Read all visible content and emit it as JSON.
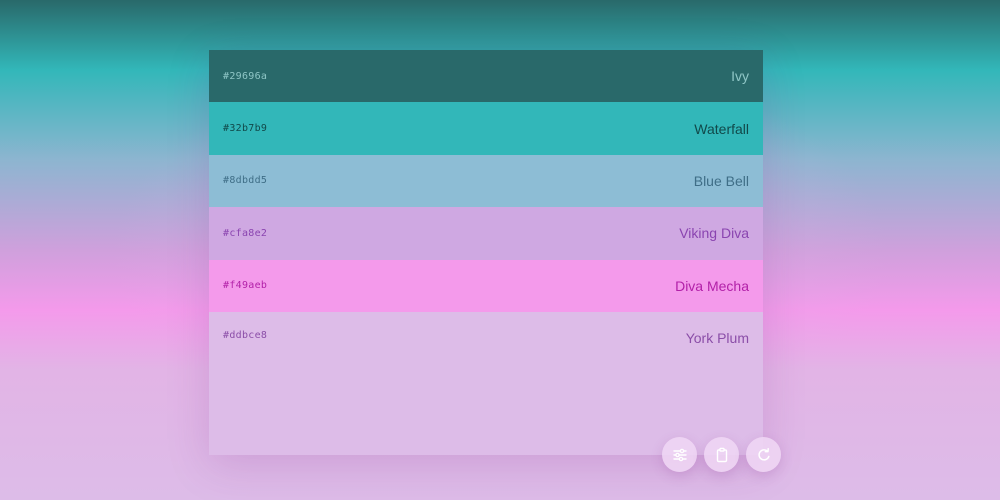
{
  "palette": {
    "swatches": [
      {
        "hex": "#29696a",
        "name": "Ivy",
        "bg": "#29696a",
        "hex_color": "#8fc6c6",
        "name_color": "#8fc6c6"
      },
      {
        "hex": "#32b7b9",
        "name": "Waterfall",
        "bg": "#32b7b9",
        "hex_color": "#11494a",
        "name_color": "#11494a"
      },
      {
        "hex": "#8dbdd5",
        "name": "Blue Bell",
        "bg": "#8dbdd5",
        "hex_color": "#3f6e87",
        "name_color": "#3f6e87"
      },
      {
        "hex": "#cfa8e2",
        "name": "Viking Diva",
        "bg": "#cfa8e2",
        "hex_color": "#8a44b0",
        "name_color": "#8a44b0"
      },
      {
        "hex": "#f49aeb",
        "name": "Diva Mecha",
        "bg": "#f49aeb",
        "hex_color": "#b221a8",
        "name_color": "#b221a8"
      },
      {
        "hex": "#ddbce8",
        "name": "York Plum",
        "bg": "#ddbce8",
        "hex_color": "#8b4ea8",
        "name_color": "#8b4ea8"
      }
    ]
  },
  "actions": {
    "adjust_icon": "sliders-icon",
    "copy_icon": "clipboard-icon",
    "refresh_icon": "refresh-icon",
    "icon_color": "#ffffff"
  }
}
